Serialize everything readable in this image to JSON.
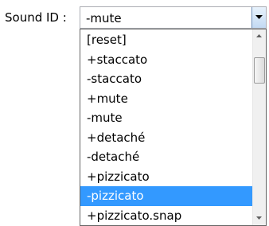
{
  "field": {
    "label": "Sound ID :",
    "value": "-mute"
  },
  "dropdown": {
    "items": [
      "[reset]",
      "+staccato",
      "-staccato",
      "+mute",
      "-mute",
      "+detaché",
      "-detaché",
      "+pizzicato",
      "-pizzicato",
      "+pizzicato.snap"
    ],
    "highlighted_index": 8
  },
  "icons": {
    "combo_button": "chevron-down-icon",
    "scroll_up": "triangle-up-icon",
    "scroll_down": "triangle-down-icon"
  },
  "colors": {
    "highlight": "#3399ff",
    "highlight_text": "#ffffff"
  }
}
